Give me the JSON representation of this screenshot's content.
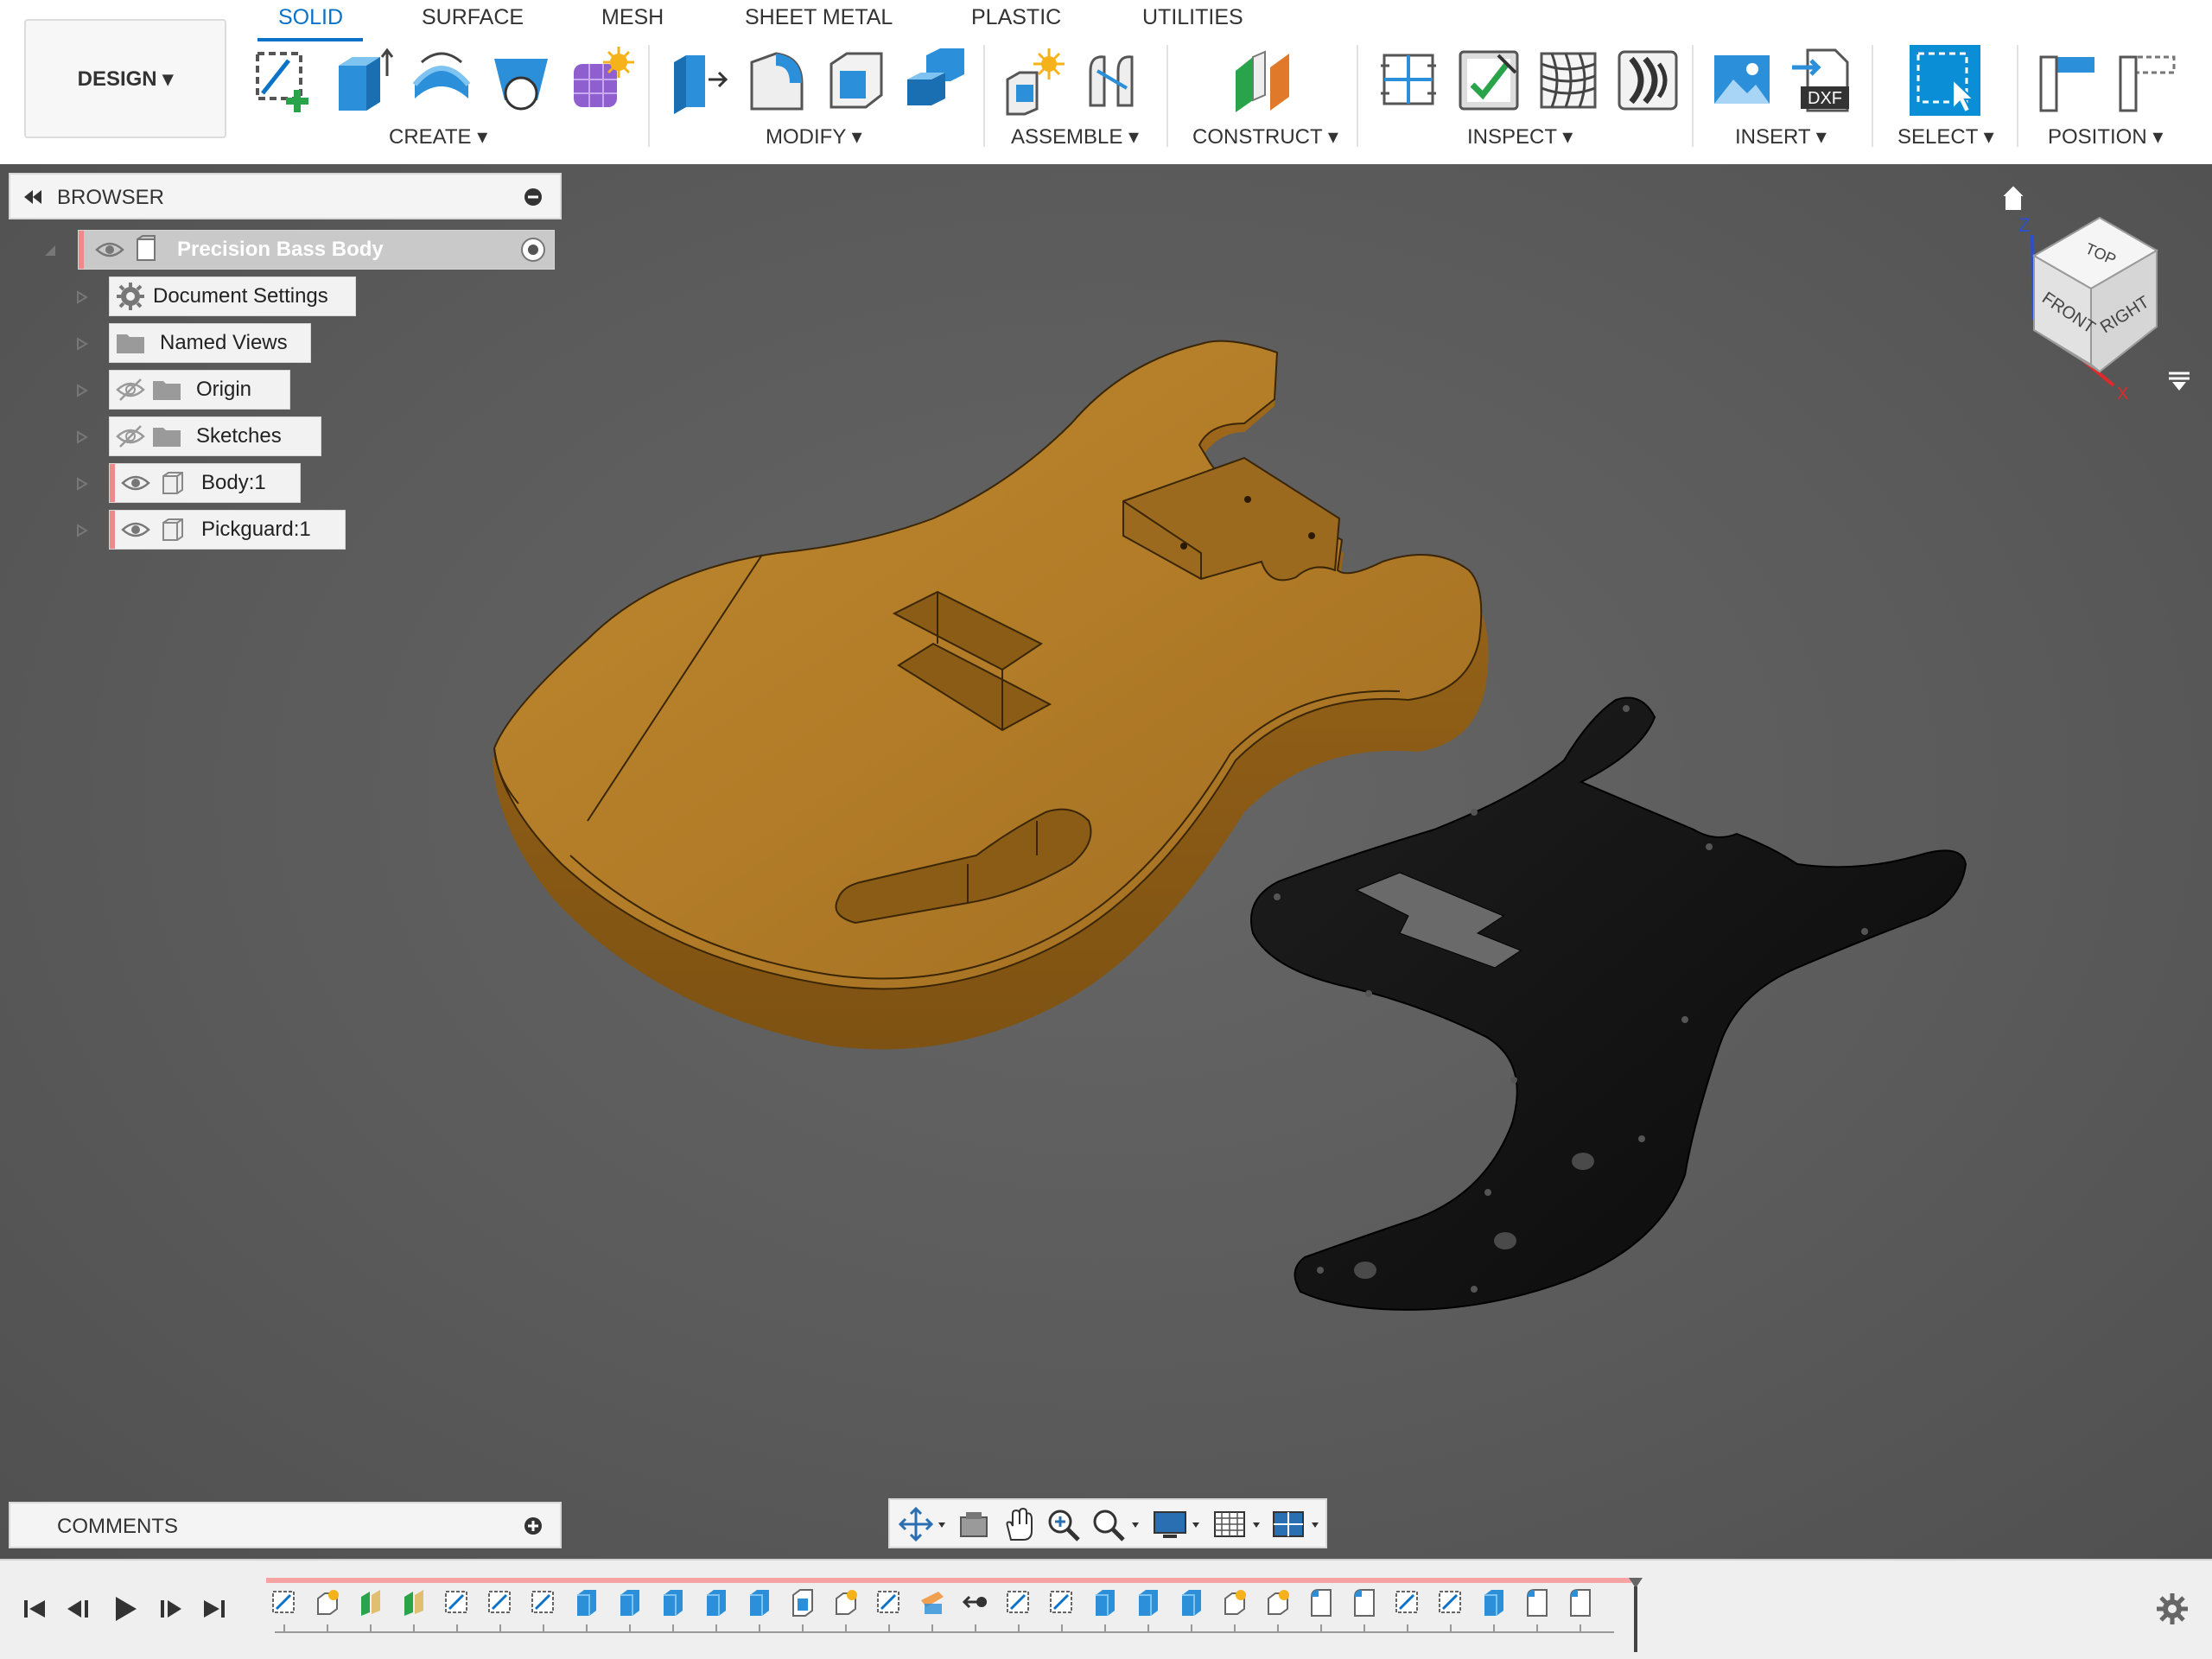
{
  "app": {
    "workspace_button": "DESIGN ▾"
  },
  "tabs": [
    {
      "label": "SOLID",
      "active": true
    },
    {
      "label": "SURFACE",
      "active": false
    },
    {
      "label": "MESH",
      "active": false
    },
    {
      "label": "SHEET METAL",
      "active": false
    },
    {
      "label": "PLASTIC",
      "active": false
    },
    {
      "label": "UTILITIES",
      "active": false
    }
  ],
  "groups": [
    {
      "label": "CREATE ▾",
      "tools": [
        "create-sketch-icon",
        "extrude-icon",
        "revolve-icon",
        "hole-icon",
        "form-icon"
      ]
    },
    {
      "label": "MODIFY ▾",
      "tools": [
        "press-pull-icon",
        "fillet-icon",
        "shell-icon",
        "combine-icon"
      ]
    },
    {
      "label": "ASSEMBLE ▾",
      "tools": [
        "new-component-icon",
        "joint-icon"
      ]
    },
    {
      "label": "CONSTRUCT ▾",
      "tools": [
        "offset-plane-icon"
      ]
    },
    {
      "label": "INSPECT ▾",
      "tools": [
        "measure-icon",
        "interference-icon",
        "zebra-analysis-icon",
        "curvature-icon"
      ]
    },
    {
      "label": "INSERT ▾",
      "tools": [
        "insert-image-icon",
        "insert-dxf-icon"
      ]
    },
    {
      "label": "SELECT ▾",
      "tools": [
        "select-icon"
      ]
    },
    {
      "label": "POSITION ▾",
      "tools": [
        "capture-position-icon",
        "revert-position-icon"
      ]
    }
  ],
  "dxf_badge": "DXF",
  "browser": {
    "title": "BROWSER",
    "root": "Precision Bass Body",
    "items": [
      {
        "label": "Document Settings",
        "icon": "gear-icon"
      },
      {
        "label": "Named Views",
        "icon": "folder-icon"
      },
      {
        "label": "Origin",
        "icon": "folder-icon",
        "hidden": true
      },
      {
        "label": "Sketches",
        "icon": "folder-icon",
        "hidden": true
      },
      {
        "label": "Body:1",
        "icon": "body-icon"
      },
      {
        "label": "Pickguard:1",
        "icon": "body-icon"
      }
    ]
  },
  "comments": {
    "title": "COMMENTS"
  },
  "viewcube": {
    "top": "TOP",
    "front": "FRONT",
    "right": "RIGHT",
    "axis_z": "Z",
    "axis_x": "X"
  },
  "colors": {
    "accent": "#0a72c7",
    "body_wood": "#b07a26",
    "pickguard": "#111111",
    "viewport_bg": "#5b5b5b",
    "timeline_track": "#f5a3a3"
  },
  "timeline": {
    "feature_icons": [
      "sketch",
      "form",
      "plane",
      "plane",
      "sketch",
      "sketch",
      "sketch",
      "extrude",
      "extrude",
      "extrude",
      "extrude",
      "extrude",
      "shell",
      "form",
      "sketch",
      "combine",
      "move",
      "sketch",
      "sketch",
      "extrude",
      "extrude",
      "extrude",
      "form",
      "form",
      "fillet",
      "fillet",
      "sketch",
      "sketch",
      "extrude",
      "fillet",
      "fillet"
    ]
  }
}
